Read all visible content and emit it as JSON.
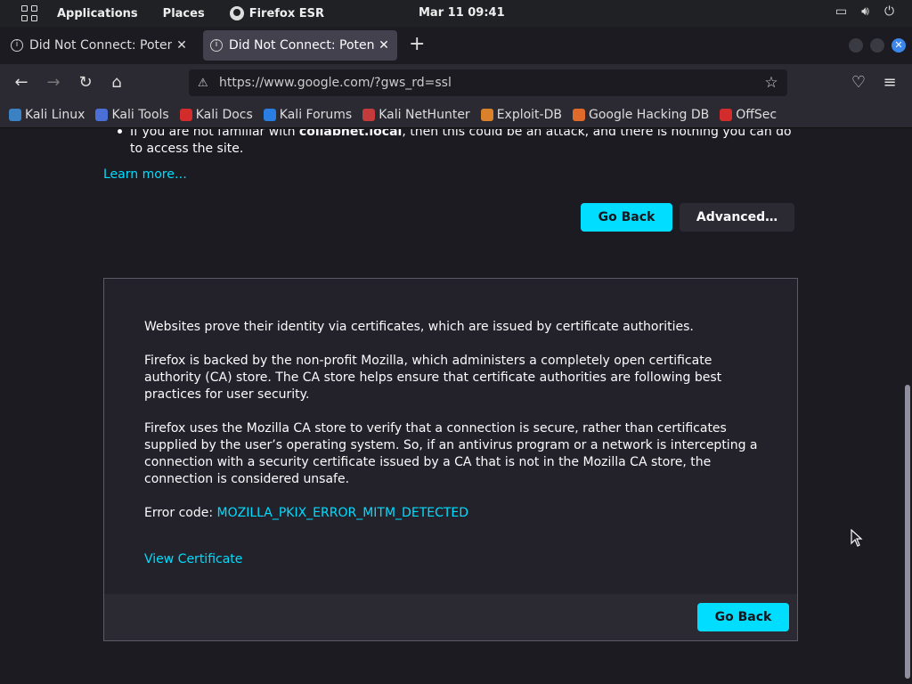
{
  "system_bar": {
    "applications": "Applications",
    "places": "Places",
    "app_name": "Firefox ESR",
    "clock": "Mar 11  09:41",
    "icons": [
      "screen-icon",
      "volume-icon",
      "power-icon"
    ]
  },
  "tabs": [
    {
      "title": "Did Not Connect: Potential Security Issue",
      "active": false
    },
    {
      "title": "Did Not Connect: Potential Security Issue",
      "active": true
    }
  ],
  "navbar": {
    "url": "https://www.google.com/?gws_rd=ssl"
  },
  "bookmarks": [
    {
      "label": "Kali Linux",
      "color": "#3b82c4"
    },
    {
      "label": "Kali Tools",
      "color": "#4a6fd6"
    },
    {
      "label": "Kali Docs",
      "color": "#d22c2c"
    },
    {
      "label": "Kali Forums",
      "color": "#2a7de1"
    },
    {
      "label": "Kali NetHunter",
      "color": "#c43b3b"
    },
    {
      "label": "Exploit-DB",
      "color": "#d9822b"
    },
    {
      "label": "Google Hacking DB",
      "color": "#e06a2a"
    },
    {
      "label": "OffSec",
      "color": "#d22c2c"
    }
  ],
  "content": {
    "bullet_text_prefix": "If you are not familiar with ",
    "bullet_host": "collabnet.local",
    "bullet_text_suffix": ", then this could be an attack, and there is nothing you can do to access the site.",
    "learn_more": "Learn more…",
    "go_back": "Go Back",
    "advanced": "Advanced…",
    "advanced_panel": {
      "p1": "Websites prove their identity via certificates, which are issued by certificate authorities.",
      "p2": "Firefox is backed by the non-profit Mozilla, which administers a completely open certificate authority (CA) store. The CA store helps ensure that certificate authorities are following best practices for user security.",
      "p3": "Firefox uses the Mozilla CA store to verify that a connection is secure, rather than certificates supplied by the user’s operating system. So, if an antivirus program or a network is intercepting a connection with a security certificate issued by a CA that is not in the Mozilla CA store, the connection is considered unsafe.",
      "error_label": "Error code: ",
      "error_code": "MOZILLA_PKIX_ERROR_MITM_DETECTED",
      "view_certificate": "View Certificate",
      "go_back": "Go Back"
    }
  },
  "colors": {
    "accent": "#00ddff",
    "background": "#1c1b22"
  }
}
